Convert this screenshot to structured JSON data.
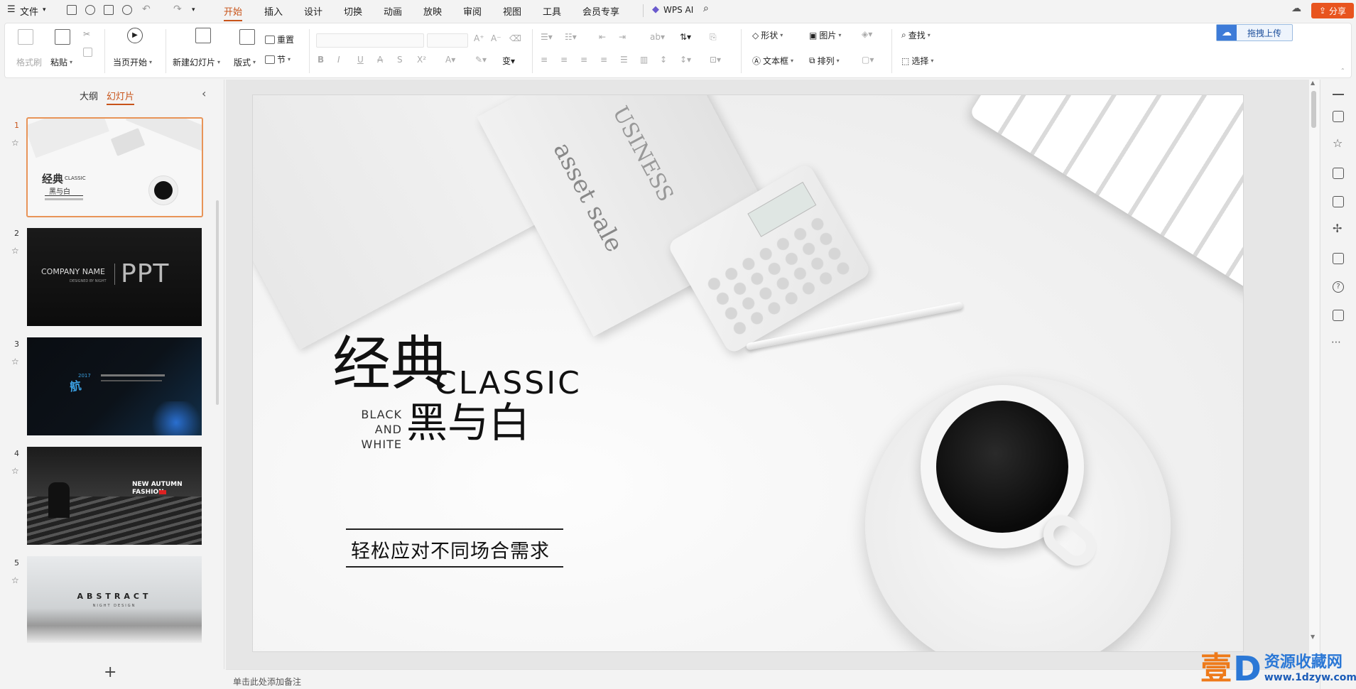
{
  "menubar": {
    "file_label": "文件",
    "tabs": [
      "开始",
      "插入",
      "设计",
      "切换",
      "动画",
      "放映",
      "审阅",
      "视图",
      "工具",
      "会员专享"
    ],
    "wps_ai": "WPS AI",
    "share": "分享"
  },
  "ribbon": {
    "format_painter": "格式刷",
    "paste": "粘贴",
    "from_current": "当页开始",
    "new_slide": "新建幻灯片",
    "layout": "版式",
    "reset": "重置",
    "section": "节",
    "shape": "形状",
    "picture": "图片",
    "textbox": "文本框",
    "arrange": "排列",
    "find": "查找",
    "select": "选择",
    "upload": "拖拽上传"
  },
  "left_panel": {
    "tab_outline": "大纲",
    "tab_slides": "幻灯片",
    "slides": [
      {
        "num": "1",
        "title": "经典",
        "subtitle": "CLASSIC",
        "line2": "黑与白"
      },
      {
        "num": "2",
        "company": "COMPANY NAME",
        "designed": "DESIGNED BY NIGHT",
        "big": "PPT"
      },
      {
        "num": "3",
        "year": "2017"
      },
      {
        "num": "4",
        "line1": "NEW AUTUMN",
        "line2": "FASHION"
      },
      {
        "num": "5",
        "title": "ABSTRACT",
        "sub": "NIGHT DESIGN"
      }
    ]
  },
  "slide": {
    "title_cn": "经典",
    "title_en": "CLASSIC",
    "word1": "BLACK",
    "word2": "AND",
    "word3": "WHITE",
    "subtitle_cn": "黑与白",
    "tagline": "轻松应对不同场合需求",
    "paper_text1": "asset sale",
    "paper_text2": "USINESS"
  },
  "notes": {
    "placeholder": "单击此处添加备注"
  },
  "watermark": {
    "big": "壹",
    "d": "D",
    "text": "资源收藏网",
    "url": "www.1dzyw.com"
  }
}
